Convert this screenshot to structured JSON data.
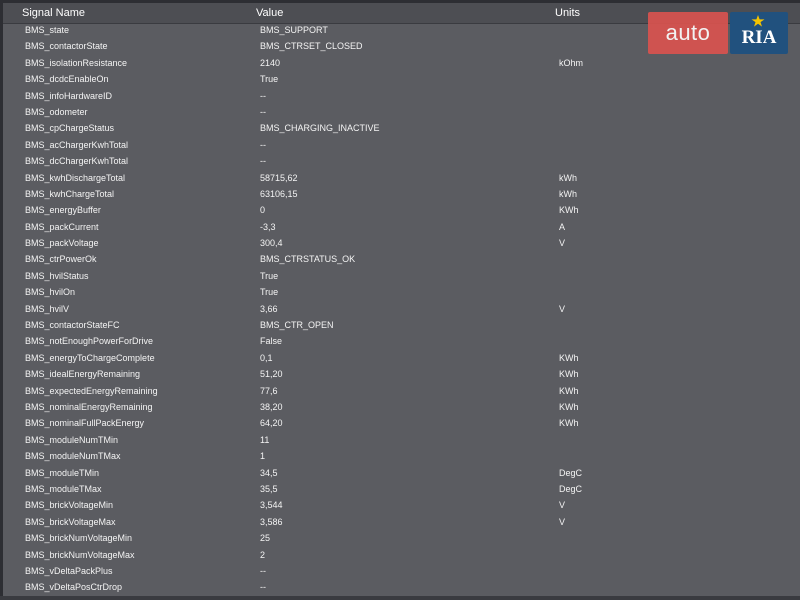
{
  "table": {
    "columns": {
      "name": "Signal Name",
      "value": "Value",
      "units": "Units"
    },
    "rows": [
      {
        "name": "BMS_state",
        "value": "BMS_SUPPORT",
        "units": ""
      },
      {
        "name": "BMS_contactorState",
        "value": "BMS_CTRSET_CLOSED",
        "units": ""
      },
      {
        "name": "BMS_isolationResistance",
        "value": "2140",
        "units": "kOhm"
      },
      {
        "name": "BMS_dcdcEnableOn",
        "value": "True",
        "units": ""
      },
      {
        "name": "BMS_infoHardwareID",
        "value": "--",
        "units": ""
      },
      {
        "name": "BMS_odometer",
        "value": "--",
        "units": ""
      },
      {
        "name": "BMS_cpChargeStatus",
        "value": "BMS_CHARGING_INACTIVE",
        "units": ""
      },
      {
        "name": "BMS_acChargerKwhTotal",
        "value": "--",
        "units": ""
      },
      {
        "name": "BMS_dcChargerKwhTotal",
        "value": "--",
        "units": ""
      },
      {
        "name": "BMS_kwhDischargeTotal",
        "value": "58715,62",
        "units": "kWh"
      },
      {
        "name": "BMS_kwhChargeTotal",
        "value": "63106,15",
        "units": "kWh"
      },
      {
        "name": "BMS_energyBuffer",
        "value": "0",
        "units": "KWh"
      },
      {
        "name": "BMS_packCurrent",
        "value": "-3,3",
        "units": "A"
      },
      {
        "name": "BMS_packVoltage",
        "value": "300,4",
        "units": "V"
      },
      {
        "name": "BMS_ctrPowerOk",
        "value": "BMS_CTRSTATUS_OK",
        "units": ""
      },
      {
        "name": "BMS_hvilStatus",
        "value": "True",
        "units": ""
      },
      {
        "name": "BMS_hvilOn",
        "value": "True",
        "units": ""
      },
      {
        "name": "BMS_hvilV",
        "value": "3,66",
        "units": "V"
      },
      {
        "name": "BMS_contactorStateFC",
        "value": "BMS_CTR_OPEN",
        "units": ""
      },
      {
        "name": "BMS_notEnoughPowerForDrive",
        "value": "False",
        "units": ""
      },
      {
        "name": "BMS_energyToChargeComplete",
        "value": "0,1",
        "units": "KWh"
      },
      {
        "name": "BMS_idealEnergyRemaining",
        "value": "51,20",
        "units": "KWh"
      },
      {
        "name": "BMS_expectedEnergyRemaining",
        "value": "77,6",
        "units": "KWh"
      },
      {
        "name": "BMS_nominalEnergyRemaining",
        "value": "38,20",
        "units": "KWh"
      },
      {
        "name": "BMS_nominalFullPackEnergy",
        "value": "64,20",
        "units": "KWh"
      },
      {
        "name": "BMS_moduleNumTMin",
        "value": "11",
        "units": ""
      },
      {
        "name": "BMS_moduleNumTMax",
        "value": "1",
        "units": ""
      },
      {
        "name": "BMS_moduleTMin",
        "value": "34,5",
        "units": "DegC"
      },
      {
        "name": "BMS_moduleTMax",
        "value": "35,5",
        "units": "DegC"
      },
      {
        "name": "BMS_brickVoltageMin",
        "value": "3,544",
        "units": "V"
      },
      {
        "name": "BMS_brickVoltageMax",
        "value": "3,586",
        "units": "V"
      },
      {
        "name": "BMS_brickNumVoltageMin",
        "value": "25",
        "units": ""
      },
      {
        "name": "BMS_brickNumVoltageMax",
        "value": "2",
        "units": ""
      },
      {
        "name": "BMS_vDeltaPackPlus",
        "value": "--",
        "units": ""
      },
      {
        "name": "BMS_vDeltaPosCtrDrop",
        "value": "--",
        "units": ""
      }
    ]
  },
  "watermark": {
    "text_left": "auto",
    "text_right": "RIA",
    "icon": "star-icon",
    "colors": {
      "left_bg": "#d9534f",
      "right_bg": "#21517e"
    }
  }
}
